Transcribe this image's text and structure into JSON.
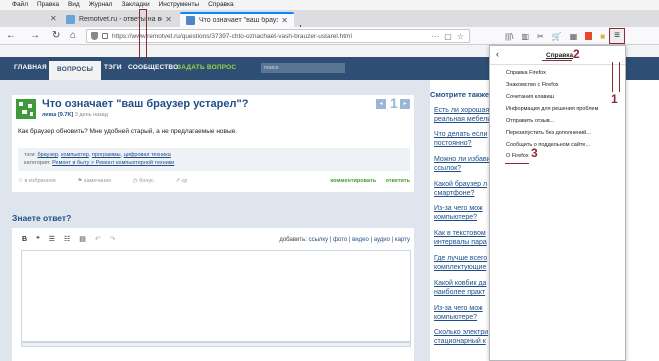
{
  "menubar": {
    "items": [
      "Файл",
      "Правка",
      "Вид",
      "Журнал",
      "Закладки",
      "Инструменты",
      "Справка"
    ]
  },
  "tabs": [
    {
      "title": "Remotvet.ru - ответы на все вопр..."
    },
    {
      "title": "Что означает \"ваш браузер уста..."
    }
  ],
  "navbar": {
    "url": "https://www.remotvet.ru/questions/37397-chto-oznachaet-vash-brauzer-ustarel.html"
  },
  "site_nav": {
    "items": [
      "ГЛАВНАЯ",
      "ВОПРОСЫ",
      "ТЭГИ",
      "СООБЩЕСТВО",
      "ЗАДАТЬ ВОПРОС"
    ],
    "search_placeholder": "поиск"
  },
  "question": {
    "title": "Что означает \"ваш браузер устарел\"?",
    "author": "левш [9.7K]",
    "time": "3 день назад",
    "votes": "1",
    "body": "Как браузер обновить? Мне удобней старый, а не предлагаемые новые.",
    "tags_label": "тэги:",
    "tags": [
      "браузер",
      "компьютер",
      "программы",
      "цифровая техника"
    ],
    "category_label": "категория:",
    "category": "Ремонт в быту > Ремонт компьютерной техники",
    "actions": [
      "в избранное",
      "замечание",
      "бонус",
      "ср"
    ],
    "actions_right": [
      "комментировать",
      "ответить"
    ]
  },
  "answer": {
    "heading": "Знаете ответ?",
    "tools": [
      "B",
      "❝",
      "☰",
      "☷",
      "▤",
      "↶",
      "↷"
    ],
    "add_label": "добавить:",
    "add_links": [
      "ссылку",
      "фото",
      "видео",
      "аудио",
      "карту"
    ]
  },
  "sidebar": {
    "title": "Смотрите также:",
    "links": [
      "Есть ли хорошая",
      "реальная мебели",
      "Что делать если",
      "постоянно?",
      "Можно ли избавить",
      "ссылок?",
      "Какой браузер л",
      "смартфоне?",
      "Из-за чего мож",
      "компьютере?",
      "Как в текстовом",
      "интервалы пара",
      "Где лучше всего",
      "комплектующие",
      "Какой ковбик да",
      "наиболее практ",
      "Из-за чего мож",
      "компьютере?",
      "Сколько электри",
      "стационарный к"
    ]
  },
  "help_panel": {
    "title": "Справка",
    "items": [
      "Справка Firefox",
      "Знакомство с Firefox",
      "Сочетания клавиш",
      "Информация для решения проблем",
      "Отправить отзыв...",
      "Перезапустить без дополнений...",
      "Сообщить о поддельном сайте...",
      "О Firefox"
    ]
  },
  "annotations": {
    "n1": "1",
    "n2": "2",
    "n3": "3"
  },
  "colors": {
    "annotation": "#8a2a36",
    "site_nav": "#2e4f73",
    "link": "#1f4f8a"
  }
}
